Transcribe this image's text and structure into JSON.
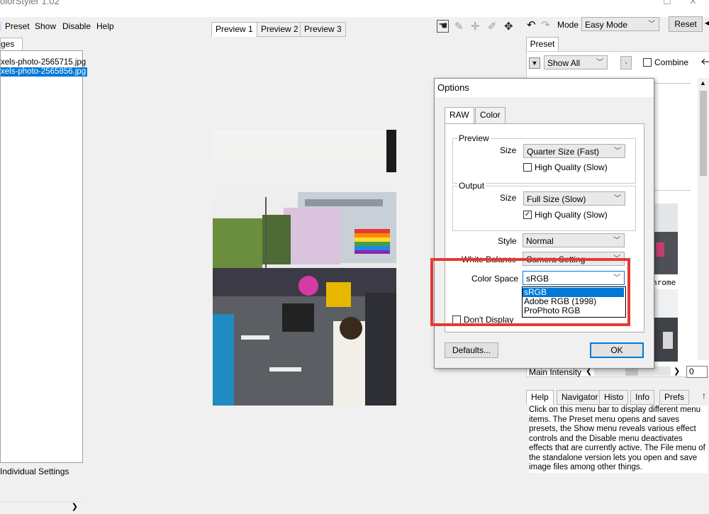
{
  "app": {
    "title": "olorStyler 1.02"
  },
  "menu": {
    "items": [
      "Preset",
      "Show",
      "Disable",
      "Help"
    ]
  },
  "preview_tabs": [
    "Preview 1",
    "Preview 2",
    "Preview 3"
  ],
  "left_panel": {
    "tab_label": "ges",
    "files": [
      "xels-photo-2565715.jpg",
      "xels-photo-2565856.jpg"
    ],
    "selected_index": 1,
    "footer": "Individual Settings"
  },
  "toolbar": {
    "icons": [
      "hand-icon",
      "eyedropper-icon",
      "crosshair-icon",
      "pencil-icon",
      "move-icon"
    ],
    "mode_label": "Mode",
    "mode_value": "Easy Mode",
    "reset_label": "Reset"
  },
  "preset_panel": {
    "tab_label": "Preset",
    "show_value": "Show All",
    "small_btn": "·",
    "combine_label": "Combine",
    "thumb_caption": "hrome",
    "main_intensity_label": "Main Intensity",
    "main_intensity_value": "0"
  },
  "help_panel": {
    "tabs": [
      "Help",
      "Navigator",
      "Histo",
      "Info",
      "Prefs"
    ],
    "text": "Click on this menu bar to display different menu items. The Preset menu opens and saves presets, the Show menu reveals various effect controls and the Disable menu deactivates effects that are currently active. The File menu of the standalone version lets you open and save image files among other things."
  },
  "dialog": {
    "title": "Options",
    "tabs": [
      "RAW",
      "Color"
    ],
    "preview": {
      "label": "Preview",
      "size_label": "Size",
      "size_value": "Quarter Size (Fast)",
      "hq_label": "High Quality (Slow)",
      "hq_checked": false
    },
    "output": {
      "label": "Output",
      "size_label": "Size",
      "size_value": "Full Size (Slow)",
      "hq_label": "High Quality (Slow)",
      "hq_checked": true
    },
    "style_label": "Style",
    "style_value": "Normal",
    "wb_label": "White Balance",
    "wb_value": "Camera Setting",
    "color_space_label": "Color Space",
    "color_space_value": "sRGB",
    "color_space_options": [
      "sRGB",
      "Adobe RGB (1998)",
      "ProPhoto RGB"
    ],
    "dont_display_label": "Don't Display",
    "defaults_label": "Defaults...",
    "ok_label": "OK"
  },
  "colors": {
    "highlight": "#0078d7",
    "annotation": "#e53935",
    "window_bg": "#f0f0f0"
  }
}
